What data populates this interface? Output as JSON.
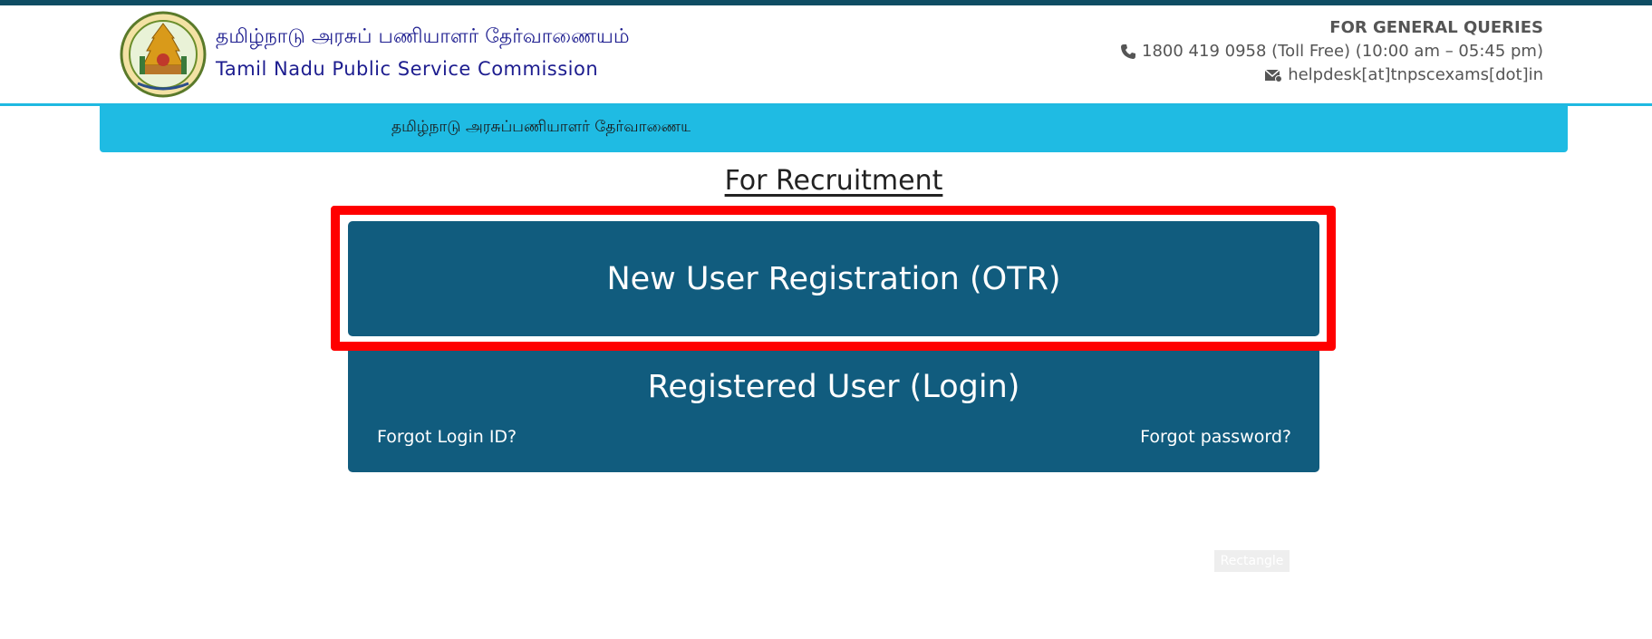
{
  "header": {
    "title_tamil": "தமிழ்நாடு அரசுப் பணியாளர் தேர்வாணையம்",
    "title_english": "Tamil Nadu Public Service Commission",
    "emblem_icon": "tn-government-emblem-icon"
  },
  "queries": {
    "title": "FOR GENERAL QUERIES",
    "phone": "1800 419 0958 (Toll Free) (10:00 am – 05:45 pm)",
    "email": "helpdesk[at]tnpscexams[dot]in",
    "phone_icon": "phone-icon",
    "email_icon": "mail-icon"
  },
  "marquee": {
    "text": "தமிழ்நாடு அரசுப்பணியாளர் தேர்வாணையம்"
  },
  "main": {
    "section_title": "For Recruitment",
    "new_user_button": "New User Registration (OTR)",
    "login_button": "Registered User (Login)",
    "forgot_login_id": "Forgot Login ID?",
    "forgot_password": "Forgot password?"
  },
  "overlay": {
    "rectangle_label": "Rectangle"
  },
  "colors": {
    "top_bar": "#0e4d63",
    "accent_cyan": "#1fbbe3",
    "panel_blue": "#115c7e",
    "highlight_red": "#ff0000",
    "title_navy": "#1d1d8f"
  }
}
